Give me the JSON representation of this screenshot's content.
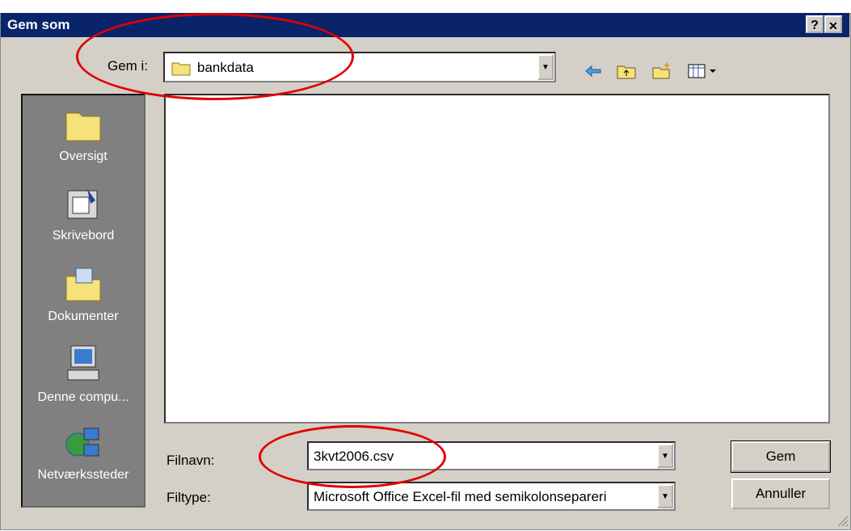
{
  "window": {
    "title": "Gem som",
    "help_button": "?",
    "close_button": "✕"
  },
  "save_in": {
    "label": "Gem i:",
    "value": "bankdata"
  },
  "places": [
    {
      "label": "Oversigt",
      "icon": "folder-icon"
    },
    {
      "label": "Skrivebord",
      "icon": "desktop-icon"
    },
    {
      "label": "Dokumenter",
      "icon": "documents-icon"
    },
    {
      "label": "Denne compu...",
      "icon": "computer-icon"
    },
    {
      "label": "Netværkssteder",
      "icon": "network-icon"
    }
  ],
  "filename": {
    "label": "Filnavn:",
    "value": "3kvt2006.csv"
  },
  "filetype": {
    "label": "Filtype:",
    "value": "Microsoft Office Excel-fil med semikolonsepareri"
  },
  "buttons": {
    "save": "Gem",
    "cancel": "Annuller"
  },
  "colors": {
    "titlebar": "#0a246a",
    "dialog": "#d4d0c8",
    "annotation": "#e00000"
  }
}
